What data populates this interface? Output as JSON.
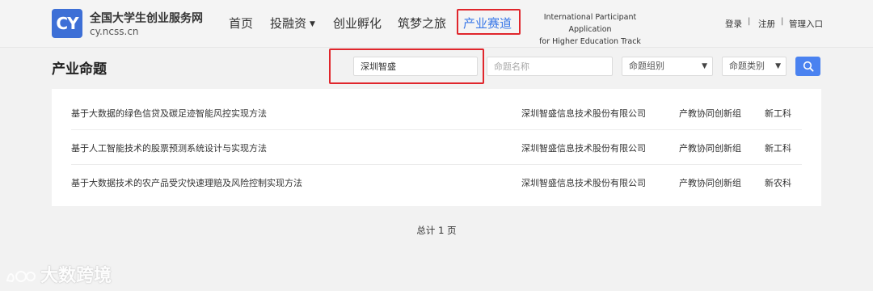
{
  "header": {
    "logo_mark": "CY",
    "site_title": "全国大学生创业服务网",
    "site_domain": "cy.ncss.cn",
    "nav": [
      {
        "label": "首页"
      },
      {
        "label": "投融资"
      },
      {
        "label": "创业孵化"
      },
      {
        "label": "筑梦之旅"
      },
      {
        "label": "产业赛道",
        "active": true
      }
    ],
    "intl_line1": "International Participant Application",
    "intl_line2": "for Higher Education Track",
    "login": "登录",
    "register": "注册",
    "admin": "管理入口",
    "separator": "|"
  },
  "filters": {
    "page_title": "产业命题",
    "keyword_value": "深圳智盛",
    "name_placeholder": "命题名称",
    "group_select": "命题组别",
    "type_select": "命题类别"
  },
  "table": {
    "rows": [
      {
        "title": "基于大数据的绿色信贷及碳足迹智能风控实现方法",
        "company": "深圳智盛信息技术股份有限公司",
        "group": "产教协同创新组",
        "category": "新工科"
      },
      {
        "title": "基于人工智能技术的股票预测系统设计与实现方法",
        "company": "深圳智盛信息技术股份有限公司",
        "group": "产教协同创新组",
        "category": "新工科"
      },
      {
        "title": "基于大数据技术的农产品受灾快速理赔及风险控制实现方法",
        "company": "深圳智盛信息技术股份有限公司",
        "group": "产教协同创新组",
        "category": "新农科"
      }
    ]
  },
  "pagination": {
    "total_text": "总计 1 页"
  },
  "watermark": {
    "text": "大数跨境"
  },
  "colors": {
    "accent": "#3a78e8",
    "highlight": "#e0262c",
    "search_button": "#4a82f0"
  }
}
